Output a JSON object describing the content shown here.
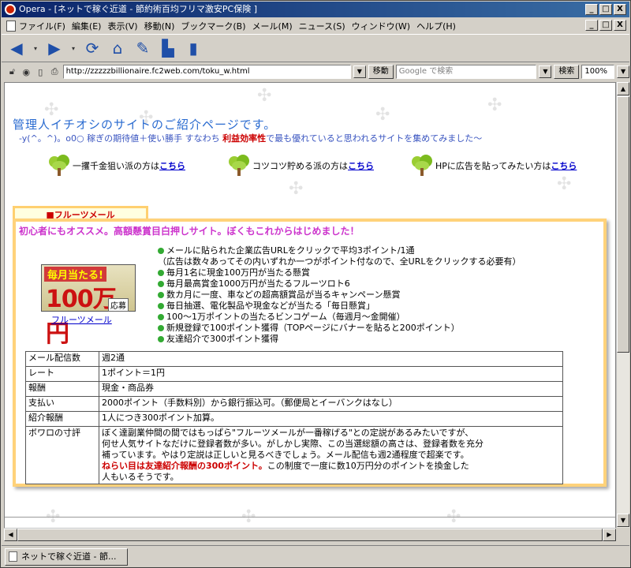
{
  "window": {
    "title": "Opera - [ネットで稼ぐ近道 - 節約術百均フリマ激安PC保険 ]",
    "minimize": "_",
    "maximize": "□",
    "close": "X"
  },
  "menu": [
    "ファイル(F)",
    "編集(E)",
    "表示(V)",
    "移動(N)",
    "ブックマーク(B)",
    "メール(M)",
    "ニュース(S)",
    "ウィンドウ(W)",
    "ヘルプ(H)"
  ],
  "address": {
    "url": "http://zzzzzbillionaire.fc2web.com/toku_w.html",
    "go_label": "移動",
    "search_placeholder": "Google で検索",
    "search_label": "検索",
    "zoom": "100%"
  },
  "page": {
    "heading": "管理人イチオシのサイトのご紹介ページです。",
    "sub_prefix": "-y(^。^)。o0○  稼ぎの期待値＋使い勝手 すなわち ",
    "sub_red": "利益効率性",
    "sub_suffix": "で最も優れていると思われるサイトを集めてみました～",
    "links": [
      {
        "text": "一攫千金狙い派の方は",
        "link": "こちら"
      },
      {
        "text": "コツコツ貯める派の方は",
        "link": "こちら"
      },
      {
        "text": "HPに広告を貼ってみたい方は",
        "link": "こちら"
      }
    ],
    "tab_label": "■フルーツメール",
    "panel_title": "初心者にもオススメ。高額懸賞目白押しサイト。ぼくもこれからはじめました！",
    "banner": {
      "line1": "毎月当たる!",
      "amount": "100万円",
      "tag": "応募"
    },
    "banner_link": "フルーツメール",
    "features": [
      {
        "text": "メールに貼られた企業広告URLをクリックで平均3ポイント/1通"
      },
      {
        "text": "（広告は数々あってその内いずれか一つがポイント付なので、全URLをクリックする必要有）",
        "nodot": true
      },
      {
        "text": "毎月1名に現金100万円が当たる懸賞"
      },
      {
        "text": "毎月最高賞金1000万円が当たるフルーツロト6"
      },
      {
        "text": "数カ月に一度、車などの超高額賞品が当るキャンペーン懸賞"
      },
      {
        "text": "毎日抽選、電化製品や現金などが当たる「毎日懸賞」"
      },
      {
        "text": "100～1万ポイントの当たるビンコゲーム（毎週月～金開催）"
      },
      {
        "text": "新規登録で100ポイント獲得（TOPページにバナーを貼ると200ポイント）"
      },
      {
        "text": "友達紹介で300ポイント獲得"
      }
    ],
    "table": [
      {
        "k": "メール配信数",
        "v": "週2通"
      },
      {
        "k": "レート",
        "v": "1ポイント＝1円"
      },
      {
        "k": "報酬",
        "v": "現金・商品券"
      },
      {
        "k": "支払い",
        "v": "2000ポイント（手数料別）から銀行振込可。（郵便局とイーバンクはなし）"
      },
      {
        "k": "紹介報酬",
        "v": "1人につき300ポイント加算。"
      }
    ],
    "comment_key": "ボワロの寸評",
    "comment_lines": [
      "ぼく達副業仲間の間ではもっぱら\"フルーツメールが一番稼げる\"との定説があるみたいですが、",
      "何せ人気サイトなだけに登録者数が多い。がしかし実際、この当選総額の高さは、登録者数を充分",
      "補っています。やはり定説は正しいと見るべきでしょう。メール配信も週2通程度で超楽です。"
    ],
    "comment_red": "ねらい目は友達紹介報酬の300ポイント。",
    "comment_after_red": "この制度で一度に数10万円分のポイントを換金した",
    "comment_last": "人もいるそうです。"
  },
  "status": {
    "tab": "ネットで稼ぐ近道 - 節..."
  }
}
